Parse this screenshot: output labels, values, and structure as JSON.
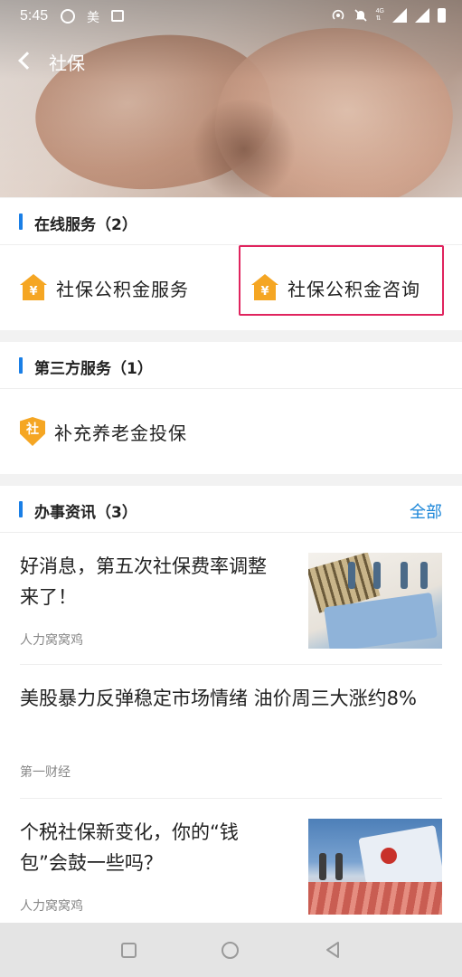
{
  "status_bar": {
    "time": "5:45",
    "carrier_text": "美",
    "network_label": "4G",
    "icons": [
      "assistant-circle-icon",
      "gallery-icon",
      "hotspot-icon",
      "mute-icon",
      "data-arrows-icon",
      "signal-icon",
      "signal-icon",
      "battery-icon"
    ]
  },
  "nav": {
    "title": "社保",
    "back_icon": "chevron-left-icon"
  },
  "online_services": {
    "title": "在线服务（2）",
    "accent_color": "#1a7fe6",
    "items": [
      {
        "label": "社保公积金服务",
        "icon": "house-yen-icon",
        "icon_text": "¥"
      },
      {
        "label": "社保公积金咨询",
        "icon": "house-yen-icon",
        "icon_text": "¥",
        "highlighted": true
      }
    ]
  },
  "third_party": {
    "title": "第三方服务（1）",
    "items": [
      {
        "label": "补充养老金投保",
        "icon": "shield-she-icon",
        "icon_text": "社"
      }
    ]
  },
  "news": {
    "title": "办事资讯（3）",
    "more_label": "全部",
    "more_color": "#1b86d8",
    "items": [
      {
        "headline": "好消息，第五次社保费率调整来了！",
        "source": "人力窝窝鸡",
        "has_thumb": true
      },
      {
        "headline": "美股暴力反弹稳定市场情绪 油价周三大涨约8%",
        "source": "第一财经",
        "has_thumb": false
      },
      {
        "headline": "个税社保新变化，你的“钱包”会鼓一些吗？",
        "source": "人力窝窝鸡",
        "has_thumb": true
      }
    ]
  },
  "highlight_color": "#e0245e",
  "icon_color": "#f5a623",
  "system_nav": [
    "recent-apps-icon",
    "home-icon",
    "back-icon"
  ]
}
